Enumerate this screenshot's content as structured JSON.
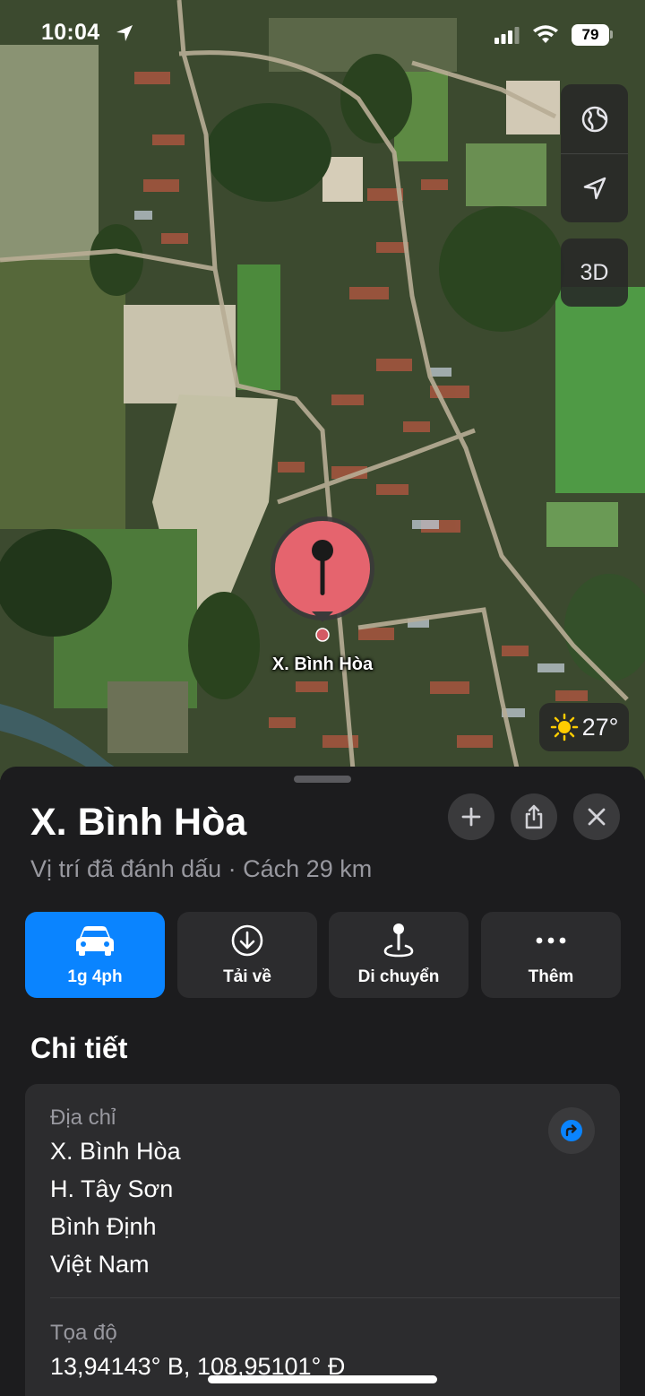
{
  "status_bar": {
    "time": "10:04",
    "battery": "79"
  },
  "map": {
    "controls": {
      "globe_icon": "globe-icon",
      "locate_icon": "location-arrow-icon",
      "three_d_label": "3D"
    },
    "pin": {
      "icon": "pushpin-icon",
      "color": "#e5646e",
      "label": "X. Bình Hòa"
    },
    "weather": {
      "icon": "sun-icon",
      "temperature": "27°"
    }
  },
  "sheet": {
    "title": "X. Bình Hòa",
    "subtitle": "Vị trí đã đánh dấu · Cách 29 km",
    "header_buttons": {
      "add_icon": "plus-icon",
      "share_icon": "share-icon",
      "close_icon": "close-icon"
    },
    "actions": [
      {
        "icon": "car-icon",
        "label": "1g 4ph",
        "primary": true
      },
      {
        "icon": "download-icon",
        "label": "Tải về"
      },
      {
        "icon": "move-pin-icon",
        "label": "Di chuyển"
      },
      {
        "icon": "more-icon",
        "label": "Thêm"
      }
    ],
    "accent_color": "#0a84ff",
    "details": {
      "section_title": "Chi tiết",
      "address_label": "Địa chỉ",
      "address_lines": [
        "X. Bình Hòa",
        "H. Tây Sơn",
        "Bình Định",
        "Việt Nam"
      ],
      "directions_icon": "directions-icon",
      "coordinates_label": "Tọa độ",
      "coordinates": "13,94143° B, 108,95101° Đ"
    }
  }
}
